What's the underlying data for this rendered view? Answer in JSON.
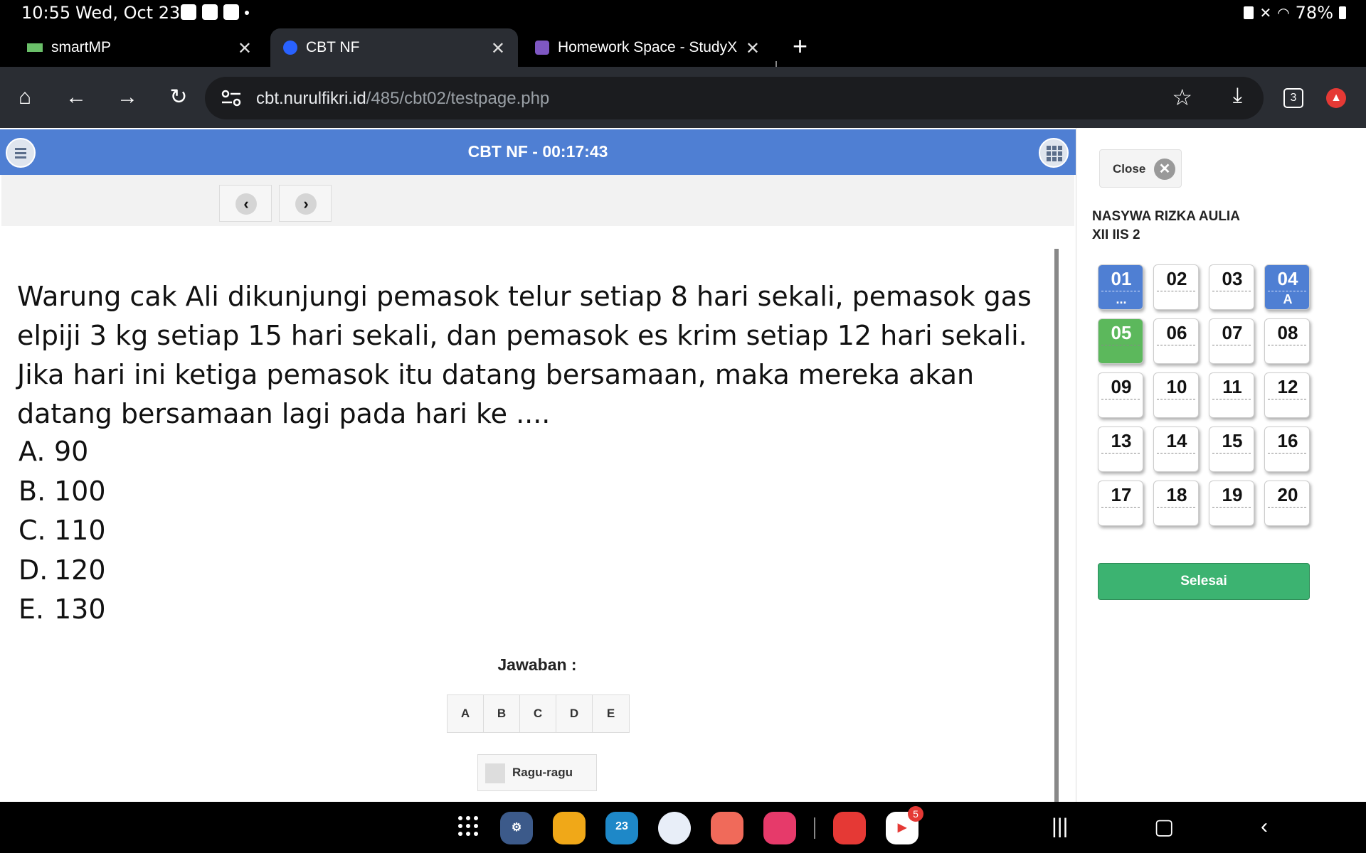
{
  "status_bar": {
    "time": "10:55",
    "date": "Wed, Oct 23",
    "battery": "78%",
    "icons": [
      "cloud-icon",
      "gallery-icon",
      "check-icon",
      "dot-icon",
      "lock-icon",
      "mute-icon",
      "wifi-icon",
      "battery-icon"
    ]
  },
  "tabs": [
    {
      "label": "smartMP",
      "icon": "smartmp-icon",
      "active": false
    },
    {
      "label": "CBT NF",
      "icon": "cbt-icon",
      "active": true
    },
    {
      "label": "Homework Space - StudyX",
      "icon": "studyx-icon",
      "active": false
    }
  ],
  "toolbar": {
    "url_host": "cbt.nurulfikri.id",
    "url_path": "/485/cbt02/testpage.php",
    "tab_count": "3"
  },
  "page": {
    "title": "CBT NF - 00:17:43",
    "question": "Warung cak Ali dikunjungi pemasok telur setiap 8 hari sekali, pemasok gas elpiji 3 kg setiap 15 hari sekali, dan pemasok es krim setiap 12 hari sekali. Jika hari ini ketiga pemasok itu datang bersamaan, maka mereka akan datang bersamaan lagi pada hari ke ....",
    "options": [
      {
        "letter": "A.",
        "text": "90"
      },
      {
        "letter": "B.",
        "text": "100"
      },
      {
        "letter": "C.",
        "text": "110"
      },
      {
        "letter": "D.",
        "text": "120"
      },
      {
        "letter": "E.",
        "text": "130"
      }
    ],
    "answer_label": "Jawaban :",
    "answer_choices": [
      "A",
      "B",
      "C",
      "D",
      "E"
    ],
    "doubt_label": "Ragu-ragu"
  },
  "side": {
    "close_label": "Close",
    "student_name": "NASYWA RIZKA AULIA",
    "student_class": "XII IIS 2",
    "finish_label": "Selesai",
    "questions": [
      {
        "num": "01",
        "answer": "...",
        "state": "answered"
      },
      {
        "num": "02",
        "answer": "",
        "state": "empty"
      },
      {
        "num": "03",
        "answer": "",
        "state": "empty"
      },
      {
        "num": "04",
        "answer": "A",
        "state": "answered"
      },
      {
        "num": "05",
        "answer": "",
        "state": "current"
      },
      {
        "num": "06",
        "answer": "",
        "state": "empty"
      },
      {
        "num": "07",
        "answer": "",
        "state": "empty"
      },
      {
        "num": "08",
        "answer": "",
        "state": "empty"
      },
      {
        "num": "09",
        "answer": "",
        "state": "empty"
      },
      {
        "num": "10",
        "answer": "",
        "state": "empty"
      },
      {
        "num": "11",
        "answer": "",
        "state": "empty"
      },
      {
        "num": "12",
        "answer": "",
        "state": "empty"
      },
      {
        "num": "13",
        "answer": "",
        "state": "empty"
      },
      {
        "num": "14",
        "answer": "",
        "state": "empty"
      },
      {
        "num": "15",
        "answer": "",
        "state": "empty"
      },
      {
        "num": "16",
        "answer": "",
        "state": "empty"
      },
      {
        "num": "17",
        "answer": "",
        "state": "empty"
      },
      {
        "num": "18",
        "answer": "",
        "state": "empty"
      },
      {
        "num": "19",
        "answer": "",
        "state": "empty"
      },
      {
        "num": "20",
        "answer": "",
        "state": "empty"
      }
    ]
  },
  "dock": {
    "calendar_day": "23",
    "youtube_badge": "5"
  },
  "colors": {
    "header_blue": "#4f7fd3",
    "current_green": "#5cb85c",
    "finish_green": "#3cb371"
  }
}
